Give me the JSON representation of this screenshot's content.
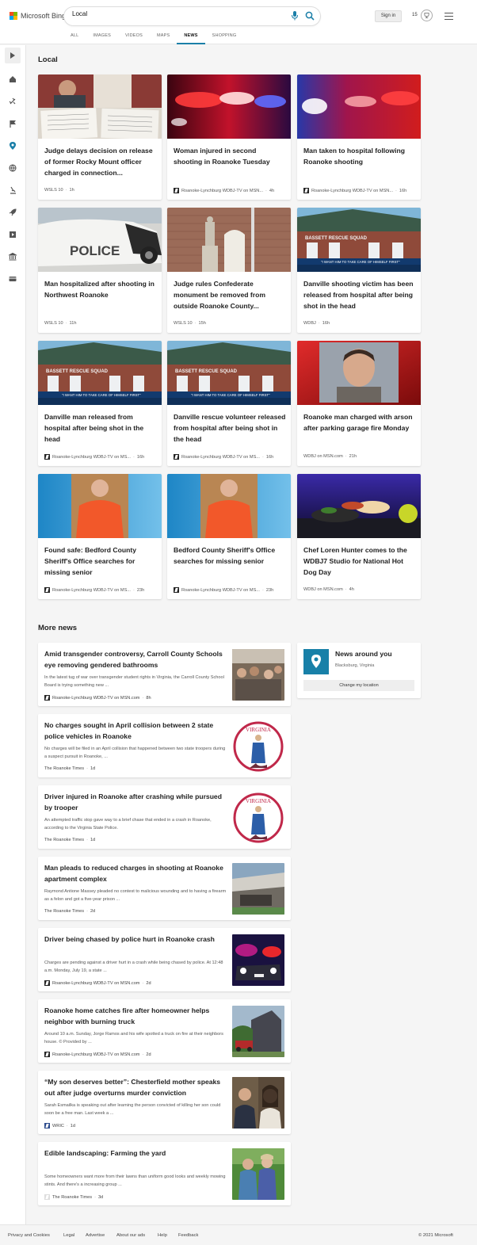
{
  "header": {
    "logo_text": "Microsoft Bing",
    "search_value": "Local",
    "signin_label": "Sign in",
    "rewards_points": "15",
    "nav": [
      "ALL",
      "IMAGES",
      "VIDEOS",
      "MAPS",
      "NEWS",
      "SHOPPING"
    ],
    "active_nav": "NEWS"
  },
  "sidebar": {
    "icons": [
      "expand-icon",
      "home-icon",
      "satellite-icon",
      "flag-icon",
      "location-icon",
      "globe-icon",
      "science-icon",
      "rocket-icon",
      "video-icon",
      "government-icon",
      "card-icon"
    ]
  },
  "local": {
    "title": "Local",
    "cards": [
      {
        "title": "Judge delays decision on release of former Rocky Mount officer charged in connection...",
        "source": "WSLS 10",
        "time": "1h"
      },
      {
        "title": "Woman injured in second shooting in Roanoke Tuesday",
        "source": "Roanoke-Lynchburg WDBJ-TV on MSN...",
        "time": "4h"
      },
      {
        "title": "Man taken to hospital following Roanoke shooting",
        "source": "Roanoke-Lynchburg WDBJ-TV on MSN...",
        "time": "16h"
      },
      {
        "title": "Man hospitalized after shooting in Northwest Roanoke",
        "source": "WSLS 10",
        "time": "11h"
      },
      {
        "title": "Judge rules Confederate monument be removed from outside Roanoke County...",
        "source": "WSLS 10",
        "time": "15h"
      },
      {
        "title": "Danville shooting victim has been released from hospital after being shot in the head",
        "source": "WDBJ",
        "time": "16h"
      },
      {
        "title": "Danville man released from hospital after being shot in the head",
        "source": "Roanoke-Lynchburg WDBJ-TV on MS...",
        "time": "16h"
      },
      {
        "title": "Danville rescue volunteer released from hospital after being shot in the head",
        "source": "Roanoke-Lynchburg WDBJ-TV on MS...",
        "time": "16h"
      },
      {
        "title": "Roanoke man charged with arson after parking garage fire Monday",
        "source": "WDBJ on MSN.com",
        "time": "21h"
      },
      {
        "title": "Found safe: Bedford County Sheriff's Office searches for missing senior",
        "source": "Roanoke-Lynchburg WDBJ-TV on MS...",
        "time": "23h"
      },
      {
        "title": "Bedford County Sheriff's Office searches for missing senior",
        "source": "Roanoke-Lynchburg WDBJ-TV on MS...",
        "time": "23h"
      },
      {
        "title": "Chef Loren Hunter comes to the WDBJ7 Studio for National Hot Dog Day",
        "source": "WDBJ on MSN.com",
        "time": "4h"
      }
    ],
    "image_captions": {
      "bassett": "BASSETT RESCUE SQUAD",
      "banner": "\"I WANT HIM TO TAKE CARE OF HIMSELF FIRST\"",
      "police": "POLICE"
    }
  },
  "more_news": {
    "title": "More news",
    "items": [
      {
        "title": "Amid transgender controversy, Carroll County Schools eye removing gendered bathrooms",
        "snippet": "In the latest tug of war over transgender student rights in Virginia, the Carroll County School Board is trying something new ...",
        "source": "Roanoke-Lynchburg WDBJ-TV on MSN.com",
        "time": "8h"
      },
      {
        "title": "No charges sought in April collision between 2 state police vehicles in Roanoke",
        "snippet": "No charges will be filed in an April collision that happened between two state troopers during a suspect pursuit in Roanoke, ...",
        "source": "The Roanoke Times",
        "time": "1d"
      },
      {
        "title": "Driver injured in Roanoke after crashing while pursued by trooper",
        "snippet": "An attempted traffic stop gave way to a brief chase that ended in a crash in Roanoke, according to the Virginia State Police.",
        "source": "The Roanoke Times",
        "time": "1d"
      },
      {
        "title": "Man pleads to reduced charges in shooting at Roanoke apartment complex",
        "snippet": "Raymond Antione Massey pleaded no contest to malicious wounding and to having a firearm as a felon and got a five-year prison ...",
        "source": "The Roanoke Times",
        "time": "2d"
      },
      {
        "title": "Driver being chased by police hurt in Roanoke crash",
        "snippet": "Charges are pending against a driver hurt in a crash while being chased by police. At 12:48 a.m. Monday, July 19, a state ...",
        "source": "Roanoke-Lynchburg WDBJ-TV on MSN.com",
        "time": "2d"
      },
      {
        "title": "Roanoke home catches fire after homeowner helps neighbor with burning truck",
        "snippet": "Around 10 a.m. Sunday, Jorge Ramos and his wife spotted a truck on fire at their neighbors house. © Provided by ...",
        "source": "Roanoke-Lynchburg WDBJ-TV on MSN.com",
        "time": "2d"
      },
      {
        "title": "“My son deserves better”: Chesterfield mother speaks out after judge overturns murder conviction",
        "snippet": "Sarah Esmailka is speaking out after learning the person convicted of killing her son could soon be a free man. Last week a ...",
        "source": "WRIC",
        "time": "1d"
      },
      {
        "title": "Edible landscaping: Farming the yard",
        "snippet": "Some homeowners want more from their lawns than uniform good looks and weekly mowing stints. And there's a increasing group ...",
        "source": "The Roanoke Times",
        "time": "3d"
      }
    ],
    "seal_text": "VIRGINIA"
  },
  "news_around": {
    "title": "News around you",
    "location": "Blacksburg, Virginia",
    "button": "Change my location"
  },
  "footer": {
    "links": [
      "Privacy and Cookies",
      "Legal",
      "Advertise",
      "About our ads",
      "Help",
      "Feedback"
    ],
    "copyright": "© 2021 Microsoft"
  }
}
